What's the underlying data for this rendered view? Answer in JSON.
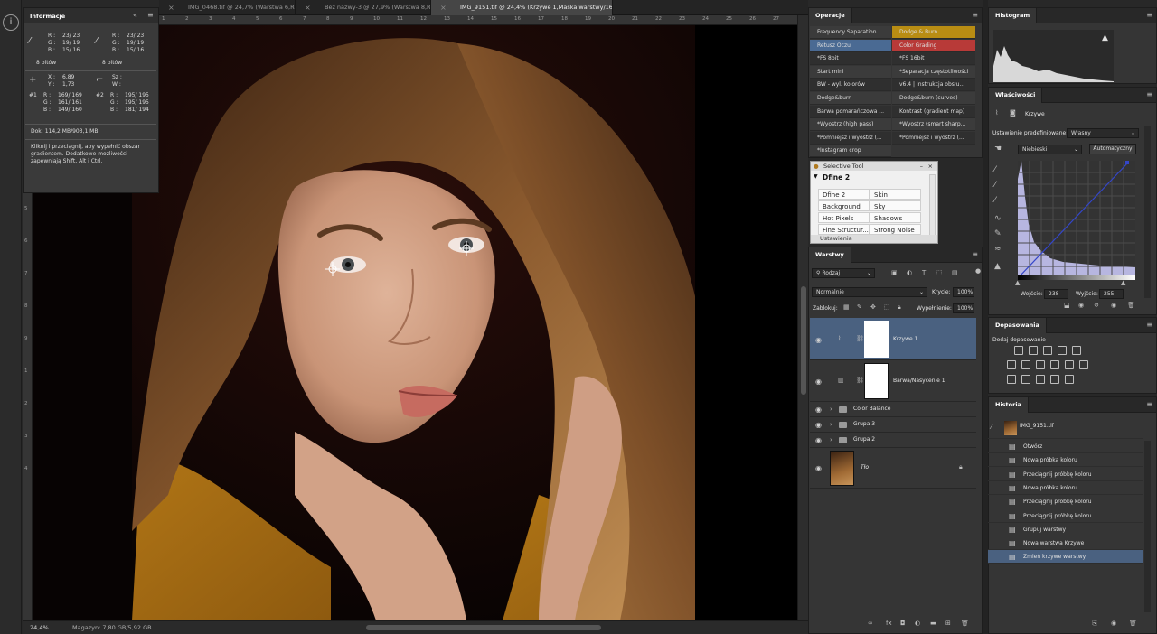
{
  "tabs": [
    {
      "label": "IMG_0468.tif @ 24,7% (Warstwa 6,RGB/16\")",
      "active": false
    },
    {
      "label": "Bez nazwy-3 @ 27,9% (Warstwa 8,RGB/16\")",
      "active": false
    },
    {
      "label": "IMG_9151.tif @ 24,4% (Krzywe 1,Maska warstwy/16) *",
      "active": true
    }
  ],
  "ruler_top": [
    "1",
    "2",
    "3",
    "4",
    "5",
    "6",
    "7",
    "8",
    "9",
    "10",
    "11",
    "12",
    "13",
    "14",
    "15",
    "16",
    "17",
    "18",
    "19",
    "20",
    "21",
    "22",
    "23",
    "24",
    "25",
    "26",
    "27"
  ],
  "ruler_left": [
    "0",
    "1",
    "2",
    "3",
    "4",
    "5",
    "6",
    "7",
    "8",
    "9",
    "1",
    "2",
    "3",
    "4"
  ],
  "info": {
    "title": "Informacje",
    "c1": {
      "r": "23/  23",
      "g": "19/  19",
      "b": "15/  16"
    },
    "c2": {
      "r": "23/  23",
      "g": "19/  19",
      "b": "15/  16"
    },
    "bits1": "8 bitów",
    "bits2": "8 bitów",
    "x": "6,89",
    "y": "1,73",
    "s_label": "Sz :",
    "w_label": "W :",
    "s1": {
      "label": "#1",
      "r": "169/ 169",
      "g": "161/ 161",
      "b": "149/ 160"
    },
    "s2": {
      "label": "#2",
      "r": "195/ 195",
      "g": "195/ 195",
      "b": "181/ 194"
    },
    "doc": "Dok: 114,2 MB/903,1 MB",
    "hint": "Kliknij i przeciągnij, aby wypełnić obszar gradientem. Dodatkowe możliwości zapewniają Shift, Alt i Ctrl."
  },
  "status": {
    "zoom": "24,4%",
    "memory": "Magazyn: 7,80 GB/5,92 GB"
  },
  "actions": {
    "title": "Operacje",
    "items": [
      {
        "label": "Frequency Separation",
        "color": "#3b3b3b"
      },
      {
        "label": "Dodge & Burn",
        "color": "#b98d13"
      },
      {
        "label": "Retusz Oczu",
        "color": "#4a6a93"
      },
      {
        "label": "Color Grading",
        "color": "#b83a38"
      },
      {
        "label": "*FS 8bit",
        "color": "#2f2f2f"
      },
      {
        "label": "*FS 16bit",
        "color": "#2f2f2f"
      },
      {
        "label": "Start mini",
        "color": "#3b3b3b"
      },
      {
        "label": "*Separacja częstotliwości",
        "color": "#3b3b3b"
      },
      {
        "label": "BW - wyl. kolorów",
        "color": "#2f2f2f"
      },
      {
        "label": "v6.4 | Instrukcja obsłu...",
        "color": "#2f2f2f"
      },
      {
        "label": "Dodge&burn",
        "color": "#3b3b3b"
      },
      {
        "label": "Dodge&burn (curves)",
        "color": "#3b3b3b"
      },
      {
        "label": "Barwa pomarańczowa ...",
        "color": "#2f2f2f"
      },
      {
        "label": "Kontrast (gradient map)",
        "color": "#2f2f2f"
      },
      {
        "label": "*Wyostrz (high pass)",
        "color": "#3b3b3b"
      },
      {
        "label": "*Wyostrz (smart sharp...",
        "color": "#3b3b3b"
      },
      {
        "label": "*Pomniejsz i wyostrz (...",
        "color": "#2f2f2f"
      },
      {
        "label": "*Pomniejsz i wyostrz (...",
        "color": "#2f2f2f"
      },
      {
        "label": "*Instagram crop",
        "color": "#3b3b3b"
      }
    ]
  },
  "selective": {
    "title": "Selective Tool",
    "heading": "Dfine 2",
    "cells": [
      [
        "Dfine 2",
        "Skin"
      ],
      [
        "Background",
        "Sky"
      ],
      [
        "Hot Pixels",
        "Shadows"
      ],
      [
        "Fine Structur...",
        "Strong Noise"
      ]
    ],
    "footer": "Ustawienia"
  },
  "layers": {
    "title": "Warstwy",
    "filter": "Rodzaj",
    "blend": "Normalnie",
    "opacity_label": "Krycie:",
    "opacity": "100%",
    "lock_label": "Zablokuj:",
    "fill_label": "Wypełnienie:",
    "fill": "100%",
    "items": [
      {
        "name": "Krzywe 1"
      },
      {
        "name": "Barwa/Nasycenie 1"
      },
      {
        "name": "Color Balance"
      },
      {
        "name": "Grupa 3"
      },
      {
        "name": "Grupa 2"
      },
      {
        "name": "Tło"
      }
    ]
  },
  "histogram": {
    "title": "Histogram"
  },
  "properties": {
    "title": "Właściwości",
    "type": "Krzywe",
    "preset_label": "Ustawienie predefiniowane:",
    "preset": "Własny",
    "channel": "Niebieski",
    "auto": "Automatyczny",
    "input_label": "Wejście:",
    "input": "238",
    "output_label": "Wyjście:",
    "output": "255"
  },
  "adjustments": {
    "title": "Dopasowania",
    "subtitle": "Dodaj dopasowanie"
  },
  "history": {
    "title": "Historia",
    "snapshot": "IMG_9151.tif",
    "items": [
      {
        "label": "Otwórz"
      },
      {
        "label": "Nowa próbka koloru"
      },
      {
        "label": "Przeciągnij próbkę koloru"
      },
      {
        "label": "Nowa próbka koloru"
      },
      {
        "label": "Przeciągnij próbkę koloru"
      },
      {
        "label": "Przeciągnij próbkę koloru"
      },
      {
        "label": "Grupuj warstwy"
      },
      {
        "label": "Nowa warstwa Krzywe"
      },
      {
        "label": "Zmień krzywe warstwy"
      }
    ]
  }
}
